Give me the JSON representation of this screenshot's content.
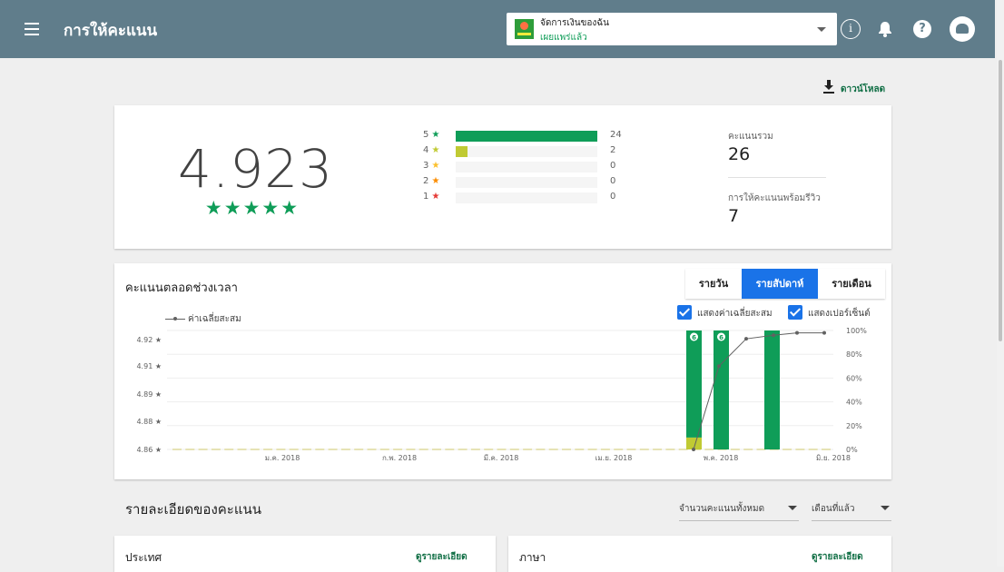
{
  "header": {
    "title": "การให้คะแนน",
    "app_name": "จัดการเงินของฉัน",
    "app_status": "เผยแพร่แล้ว",
    "info_glyph": "i",
    "help_glyph": "?"
  },
  "download": {
    "label": "ดาวน์โหลด"
  },
  "summary": {
    "average": "4.923",
    "average_stars": "★★★★★",
    "distribution": [
      {
        "stars": "5",
        "star_glyph": "★",
        "count": "24",
        "count_value": 24,
        "color": "#0f9d58"
      },
      {
        "stars": "4",
        "star_glyph": "★",
        "count": "2",
        "count_value": 2,
        "color": "#c0ca33"
      },
      {
        "stars": "3",
        "star_glyph": "★",
        "count": "0",
        "count_value": 0,
        "color": "#fbc02d"
      },
      {
        "stars": "2",
        "star_glyph": "★",
        "count": "0",
        "count_value": 0,
        "color": "#fb8c00"
      },
      {
        "stars": "1",
        "star_glyph": "★",
        "count": "0",
        "count_value": 0,
        "color": "#e53935"
      }
    ],
    "total_label": "คะแนนรวม",
    "total_value": "26",
    "reviews_label": "การให้คะแนนพร้อมรีวิว",
    "reviews_value": "7"
  },
  "timeline": {
    "title": "คะแนนตลอดช่วงเวลา",
    "tabs": [
      "รายวัน",
      "รายสัปดาห์",
      "รายเดือน"
    ],
    "active_tab": "รายสัปดาห์",
    "legend_label": "ค่าเฉลี่ยสะสม",
    "checkbox_cumulative": "แสดงค่าเฉลี่ยสะสม",
    "checkbox_percent": "แสดงเปอร์เซ็นต์",
    "accent": "#1a73e8"
  },
  "chart_data": {
    "type": "bar",
    "y_left_ticks": [
      "4.92 ★",
      "4.91 ★",
      "4.89 ★",
      "4.88 ★",
      "4.86 ★"
    ],
    "y_right_ticks": [
      "100%",
      "80%",
      "60%",
      "40%",
      "20%",
      "0%"
    ],
    "x_ticks": [
      "ม.ค. 2018",
      "ก.พ. 2018",
      "มี.ค. 2018",
      "เม.ย. 2018",
      "พ.ค. 2018",
      "มิ.ย. 2018"
    ],
    "ylim_percent": [
      0,
      100
    ],
    "bars": [
      {
        "five_star_pct": 90,
        "four_star_pct": 10,
        "badge": "6"
      },
      {
        "five_star_pct": 100,
        "four_star_pct": 0,
        "badge": "6"
      },
      {
        "five_star_pct": 100,
        "four_star_pct": 0,
        "badge": ""
      }
    ],
    "cumulative_line_pct": [
      0,
      70,
      93,
      96,
      98,
      98
    ],
    "series": [
      {
        "name": "ค่าเฉลี่ยสะสม",
        "color": "#616161"
      }
    ],
    "colors": {
      "five_star": "#0f9d58",
      "four_star": "#c0ca33",
      "baseline": "#e6e3b5"
    }
  },
  "details": {
    "title": "รายละเอียดของคะแนน",
    "metric_select": "จำนวนคะแนนทั้งหมด",
    "period_select": "เดือนที่แล้ว",
    "cards": [
      {
        "title": "ประเทศ",
        "link": "ดูรายละเอียด"
      },
      {
        "title": "ภาษา",
        "link": "ดูรายละเอียด"
      }
    ]
  }
}
